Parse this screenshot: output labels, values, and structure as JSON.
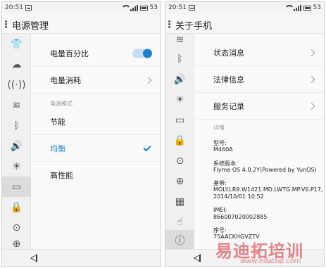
{
  "status_bar": {
    "time": "20:51",
    "battery": "53"
  },
  "left_screen": {
    "title": "电源管理",
    "sidebar_icons": [
      "shirt-icon",
      "cloud-icon",
      "signal-icon",
      "wifi-icon",
      "bluetooth-icon",
      "volume-icon",
      "brightness-icon",
      "battery-icon",
      "lock-icon",
      "location-icon",
      "globe-icon"
    ],
    "active_sidebar_index": 7,
    "items": {
      "battery_percent": {
        "label": "电量百分比",
        "toggle_on": true
      },
      "battery_usage": {
        "label": "电量消耗"
      }
    },
    "power_mode": {
      "header": "电源模式",
      "options": [
        "节能",
        "均衡",
        "高性能"
      ],
      "selected": "均衡"
    }
  },
  "right_screen": {
    "title": "关于手机",
    "sidebar_icons": [
      "wifi-icon",
      "bluetooth-icon",
      "volume-icon",
      "brightness-icon",
      "battery-icon",
      "lock-icon",
      "location-icon",
      "globe-icon",
      "apps-icon",
      "hand-icon",
      "info-icon"
    ],
    "active_sidebar_index": 10,
    "menu": [
      "状态消息",
      "法律信息",
      "服务记录"
    ],
    "details_header": "详情",
    "details": [
      {
        "label": "型号:",
        "value": "M460A"
      },
      {
        "label": "系统版本:",
        "value": "Flyme OS 4.0.2Y(Powered by YunOS)"
      },
      {
        "label": "基带:",
        "value": "MOLY.LR9.W1421.MD.LWTG.MP.V6.P17, 2014/10/01 10:52"
      },
      {
        "label": "IMEI:",
        "value": "866007020002885"
      },
      {
        "label": "序号:",
        "value": "75AACKHGVZTV"
      }
    ]
  },
  "watermark": {
    "title": "易迪拓培训",
    "url": "www.edatop.com"
  },
  "colors": {
    "accent": "#1b7fd6",
    "watermark": "#d8262c"
  }
}
